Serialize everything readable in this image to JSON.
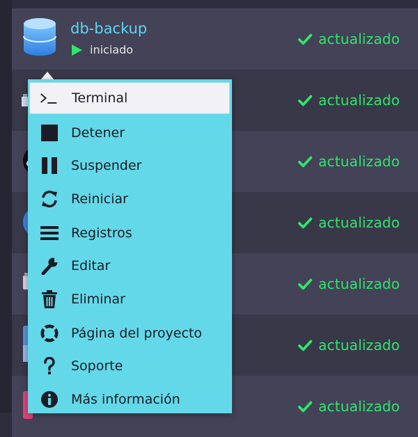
{
  "app": {
    "name": "db-backup",
    "state_label": "iniciado"
  },
  "rows": [
    {
      "status": "actualizado"
    },
    {
      "status": "actualizado"
    },
    {
      "status": "actualizado"
    },
    {
      "status": "actualizado"
    },
    {
      "status": "actualizado"
    },
    {
      "status": "actualizado"
    },
    {
      "status": "actualizado"
    }
  ],
  "menu": {
    "items": [
      {
        "label": "Terminal",
        "icon": "terminal-icon"
      },
      {
        "label": "Detener",
        "icon": "stop-icon"
      },
      {
        "label": "Suspender",
        "icon": "pause-icon"
      },
      {
        "label": "Reiniciar",
        "icon": "restart-icon"
      },
      {
        "label": "Registros",
        "icon": "logs-icon"
      },
      {
        "label": "Editar",
        "icon": "wrench-icon"
      },
      {
        "label": "Eliminar",
        "icon": "trash-icon"
      },
      {
        "label": "Página del proyecto",
        "icon": "lifebuoy-icon"
      },
      {
        "label": "Soporte",
        "icon": "question-icon"
      },
      {
        "label": "Más información",
        "icon": "info-icon"
      }
    ]
  },
  "colors": {
    "background": "#2e2d3d",
    "row_odd": "#434257",
    "row_even": "#393849",
    "status_green": "#2ee86a",
    "app_name": "#5fd7f0",
    "menu_bg": "#63d8e8",
    "menu_highlight": "#f2f2f6"
  }
}
